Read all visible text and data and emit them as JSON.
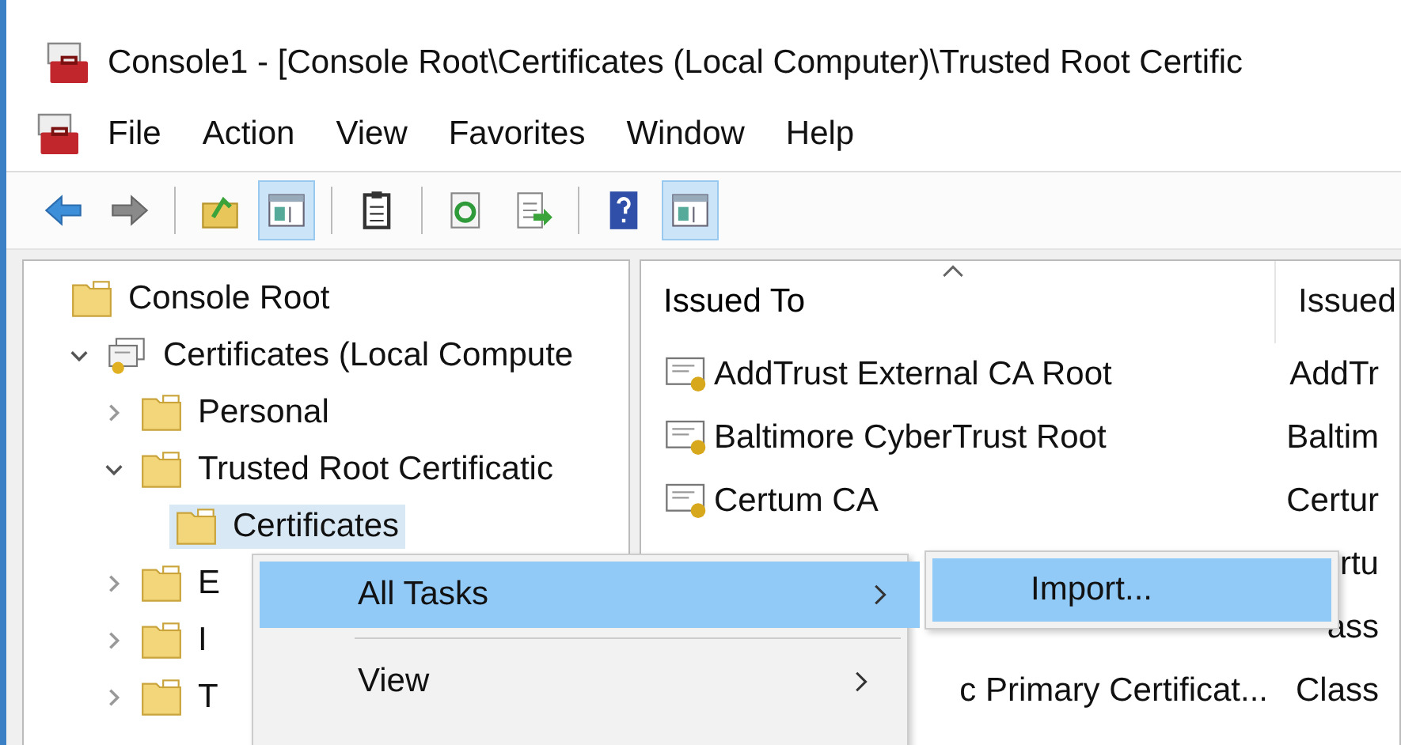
{
  "window": {
    "title": "Console1 - [Console Root\\Certificates (Local Computer)\\Trusted Root Certific"
  },
  "menu_bar": [
    "File",
    "Action",
    "View",
    "Favorites",
    "Window",
    "Help"
  ],
  "toolbar": [
    {
      "kind": "back",
      "pressed": false
    },
    {
      "kind": "forward",
      "pressed": false
    },
    {
      "kind": "separator"
    },
    {
      "kind": "up",
      "pressed": false
    },
    {
      "kind": "tree",
      "pressed": true
    },
    {
      "kind": "separator"
    },
    {
      "kind": "properties",
      "pressed": false
    },
    {
      "kind": "separator"
    },
    {
      "kind": "refresh",
      "pressed": false
    },
    {
      "kind": "export",
      "pressed": false
    },
    {
      "kind": "separator"
    },
    {
      "kind": "help",
      "pressed": false
    },
    {
      "kind": "action_pane",
      "pressed": true
    }
  ],
  "tree": [
    {
      "label": "Console Root",
      "kind": "folder",
      "selected": false,
      "children": [
        {
          "label": "Certificates (Local Compute",
          "kind": "store",
          "expanded": true,
          "selected": false,
          "children": [
            {
              "label": "Personal",
              "kind": "folder",
              "expanded": false,
              "selected": false
            },
            {
              "label": "Trusted Root Certificatic",
              "kind": "folder",
              "expanded": true,
              "selected": false,
              "children": [
                {
                  "label": "Certificates",
                  "kind": "folder",
                  "selected": true
                }
              ]
            },
            {
              "label": "E",
              "kind": "folder",
              "expanded": false,
              "selected": false
            },
            {
              "label": "I",
              "kind": "folder",
              "expanded": false,
              "selected": false
            },
            {
              "label": "T",
              "kind": "folder",
              "expanded": false,
              "selected": false
            }
          ]
        }
      ]
    }
  ],
  "list": {
    "columns": [
      {
        "label": "Issued To",
        "sorted": true
      },
      {
        "label": "Issued",
        "sorted": false
      }
    ],
    "rows": [
      {
        "issued_to": "AddTrust External CA Root",
        "column_2": "AddTr",
        "icon": true
      },
      {
        "issued_to": "Baltimore CyberTrust Root",
        "column_2": "Baltim",
        "icon": true
      },
      {
        "issued_to": "Certum CA",
        "column_2": "Certur",
        "icon": true
      },
      {
        "column_2": "rtu",
        "icon": false
      },
      {
        "column_2": "ass",
        "icon": false
      },
      {
        "issued_to": "c Primary Certificat...",
        "column_2": "Class",
        "icon": false
      }
    ]
  },
  "context_menu": {
    "items": [
      {
        "label": "All Tasks",
        "submenu": true,
        "selected": true
      },
      {
        "kind": "separator"
      },
      {
        "label": "View",
        "submenu": true,
        "selected": false
      }
    ],
    "submenu": {
      "items": [
        {
          "label": "Import...",
          "selected": true
        }
      ]
    }
  }
}
